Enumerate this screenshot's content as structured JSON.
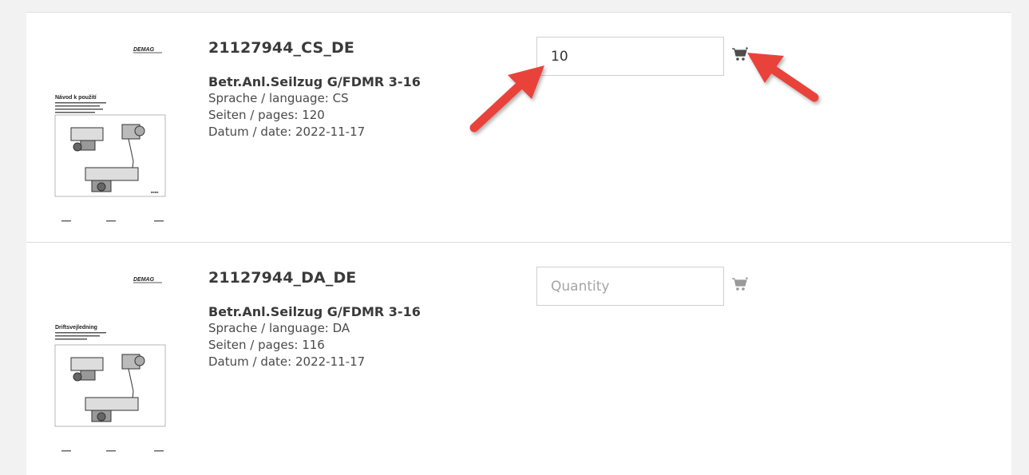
{
  "products": [
    {
      "id": "21127944_CS_DE",
      "name": "Betr.Anl.Seilzug G/FDMR 3-16",
      "language": "Sprache / language: CS",
      "pages": "Seiten / pages: 120",
      "date": "Datum / date: 2022-11-17",
      "quantity_value": "10",
      "quantity_placeholder": "Quantity",
      "thumb_heading": "Návod k použití",
      "thumb_brand": "DEMAG"
    },
    {
      "id": "21127944_DA_DE",
      "name": "Betr.Anl.Seilzug G/FDMR 3-16",
      "language": "Sprache / language: DA",
      "pages": "Seiten / pages: 116",
      "date": "Datum / date: 2022-11-17",
      "quantity_value": "",
      "quantity_placeholder": "Quantity",
      "thumb_heading": "Driftsvejledning",
      "thumb_brand": "DEMAG"
    }
  ],
  "annotations": {
    "arrow_color": "#e8423a"
  },
  "icons": {
    "cart": "shopping-cart-icon"
  }
}
